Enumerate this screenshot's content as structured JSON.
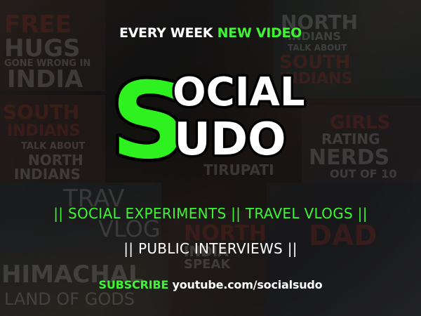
{
  "tagline": {
    "prefix": "EVERY WEEK",
    "highlight": "NEW VIDEO"
  },
  "logo": {
    "word1": "SOCIAL",
    "word2": "SUDO"
  },
  "topics_line1": "|| SOCIAL EXPERIMENTS || TRAVEL VLOGS ||",
  "topics_line2": "|| PUBLIC INTERVIEWS ||",
  "subscribe": {
    "label": "SUBSCRIBE",
    "url": "youtube.com/socialsudo"
  },
  "background_thumbnails": [
    "FREE",
    "HUGS",
    "GONE WRONG IN",
    "INDIA",
    "SOUTH",
    "INDIANS",
    "TALK ABOUT",
    "NORTH",
    "INDIANS",
    "NORTH",
    "INDIANS",
    "TALK ABOUT",
    "SOUTH",
    "INDIANS",
    "GIRLS",
    "RATING",
    "NERDS",
    "OUT OF 10",
    "TIRUPATI",
    "TRAV",
    "VLOG",
    "HIMACHAL",
    "LAND OF GODS",
    "NORTH",
    "INDIA",
    "SPEAK",
    "DAD"
  ],
  "colors": {
    "accent": "#3df533",
    "logo_green": "#2ef21f",
    "text": "#ffffff",
    "logo_outline": "#000000"
  }
}
